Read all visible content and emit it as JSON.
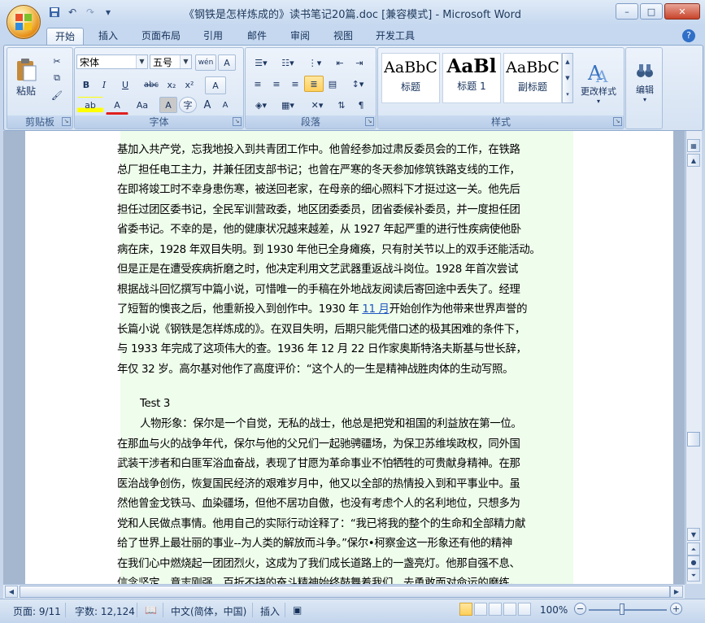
{
  "window": {
    "title": "《钢铁是怎样炼成的》读书笔记20篇.doc [兼容模式] - Microsoft Word",
    "controls": {
      "minimize": "–",
      "maximize": "□",
      "close": "✕"
    }
  },
  "qat": {
    "save": "💾",
    "undo": "↶",
    "redo": "↷",
    "customize": "▾"
  },
  "tabs": [
    "开始",
    "插入",
    "页面布局",
    "引用",
    "邮件",
    "审阅",
    "视图",
    "开发工具"
  ],
  "active_tab": "开始",
  "help": "?",
  "ribbon": {
    "clipboard": {
      "label": "剪贴板",
      "paste": "粘贴"
    },
    "font": {
      "label": "字体",
      "font_name": "宋体",
      "font_size": "五号",
      "bold": "B",
      "italic": "I",
      "underline": "U",
      "strike": "abc",
      "subscript": "x₂",
      "superscript": "x²",
      "grow": "A",
      "shrink": "A",
      "change_case": "Aa",
      "char_border": "A",
      "phonetic": "wén",
      "font_color": "A",
      "highlight": "ab",
      "clear": "A"
    },
    "paragraph": {
      "label": "段落"
    },
    "styles": {
      "label": "样式",
      "items": [
        {
          "sample": "AaBbC",
          "name": "标题"
        },
        {
          "sample": "AaBl",
          "name": "标题 1"
        },
        {
          "sample": "AaBbC",
          "name": "副标题"
        }
      ],
      "change_styles": "更改样式"
    },
    "editing": {
      "label": "编辑"
    }
  },
  "document": {
    "para1": [
      "基加入共产党，忘我地投入到共青团工作中。他曾经参加过肃反委员会的工作，在铁路",
      "总厂担任电工主力，并兼任团支部书记；也曾在严寒的冬天参加修筑铁路支线的工作，",
      "在即将竣工时不幸身患伤寒，被送回老家，在母亲的细心照料下才挺过这一关。他先后",
      "担任过团区委书记，全民军训营政委，地区团委委员，团省委候补委员，并一度担任团",
      "省委书记。不幸的是，他的健康状况越来越差，从 1927 年起严重的进行性疾病使他卧",
      "病在床，1928 年双目失明。到 1930 年他已全身瘫痪，只有肘关节以上的双手还能活动。",
      "但是正是在遭受疾病折磨之时，他决定利用文艺武器重返战斗岗位。1928 年首次尝试",
      "根据战斗回忆撰写中篇小说，可惜唯一的手稿在外地战友阅读后寄回途中丢失了。经理",
      "了短暂的懊丧之后，他重新投入到创作中。1930 年 ",
      "长篇小说《钢铁是怎样炼成的》。在双目失明，后期只能凭借口述的极其困难的条件下，",
      "与 1933 年完成了这项伟大的查。1936 年 12 月 22 日作家奥斯特洛夫斯基与世长辞，",
      "年仅 32 岁。高尔基对他作了高度评价：“这个人的一生是精神战胜肉体的生动写照。"
    ],
    "para1_link": "11 月",
    "para1_after_link": "开始创作为他带来世界声誉的",
    "heading": "Test 3",
    "para2": [
      "人物形象：保尔是一个自觉，无私的战士，他总是把党和祖国的利益放在第一位。",
      "在那血与火的战争年代，保尔与他的父兄们一起驰骋疆场，为保卫苏维埃政权，同外国",
      "武装干涉者和白匪军浴血奋战，表现了甘愿为革命事业不怕牺牲的可贵献身精神。在那",
      "医治战争创伤，恢复国民经济的艰难岁月中，他又以全部的热情投入到和平事业中。虽",
      "然他曾金戈铁马、血染疆场，但他不居功自傲，也没有考虑个人的名利地位，只想多为",
      "党和人民做点事情。他用自己的实际行动诠释了：“我已将我的整个的生命和全部精力献",
      "给了世界上最壮丽的事业--为人类的解放而斗争。”保尔•柯察金这一形象还有他的精神",
      "在我们心中燃烧起一团团烈火，这成为了我们成长道路上的一盏亮灯。他那自强不息、",
      "信念坚定、意志刚强、百折不挠的奋斗精神始终鼓舞着我们，去勇敢面对命运的磨练。"
    ]
  },
  "status": {
    "page": "页面: 9/11",
    "words": "字数: 12,124",
    "language": "中文(简体，中国)",
    "mode": "插入",
    "zoom": "100%",
    "zoom_out": "−",
    "zoom_in": "+"
  }
}
